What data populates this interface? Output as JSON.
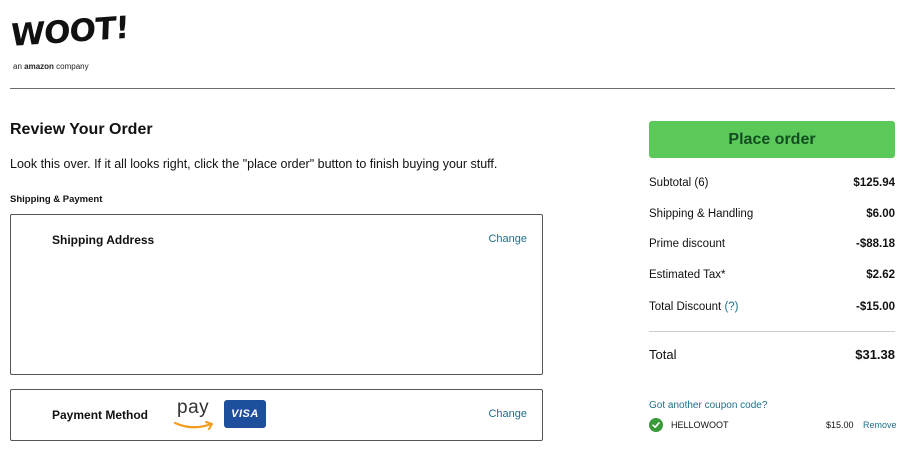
{
  "logo": {
    "word": "WOOT!",
    "sub_prefix": "an ",
    "sub_brand": "amazon",
    "sub_suffix": " company"
  },
  "page": {
    "title": "Review Your Order",
    "intro": "Look this over. If it all looks right, click the \"place order\" button to finish buying your stuff.",
    "section_label": "Shipping & Payment"
  },
  "shipping": {
    "heading": "Shipping Address",
    "change_label": "Change"
  },
  "payment": {
    "heading": "Payment Method",
    "pay_label": "pay",
    "card_brand": "VISA",
    "change_label": "Change"
  },
  "summary": {
    "place_order_label": "Place order",
    "rows": [
      {
        "label": "Subtotal (6)",
        "value": "$125.94"
      },
      {
        "label": "Shipping & Handling",
        "value": "$6.00"
      },
      {
        "label": "Prime discount",
        "value": "-$88.18"
      },
      {
        "label": "Estimated Tax*",
        "value": "$2.62"
      },
      {
        "label": "Total Discount",
        "help": "(?)",
        "value": "-$15.00"
      }
    ],
    "total_label": "Total",
    "total_value": "$31.38"
  },
  "coupon": {
    "link_label": "Got another coupon code?",
    "code": "HELLOWOOT",
    "amount": "$15.00",
    "remove_label": "Remove"
  },
  "colors": {
    "accent_link": "#1f6f8b",
    "place_order_bg": "#5ac95a",
    "visa_blue": "#1d4f9c",
    "success_green": "#3a9a3a"
  }
}
